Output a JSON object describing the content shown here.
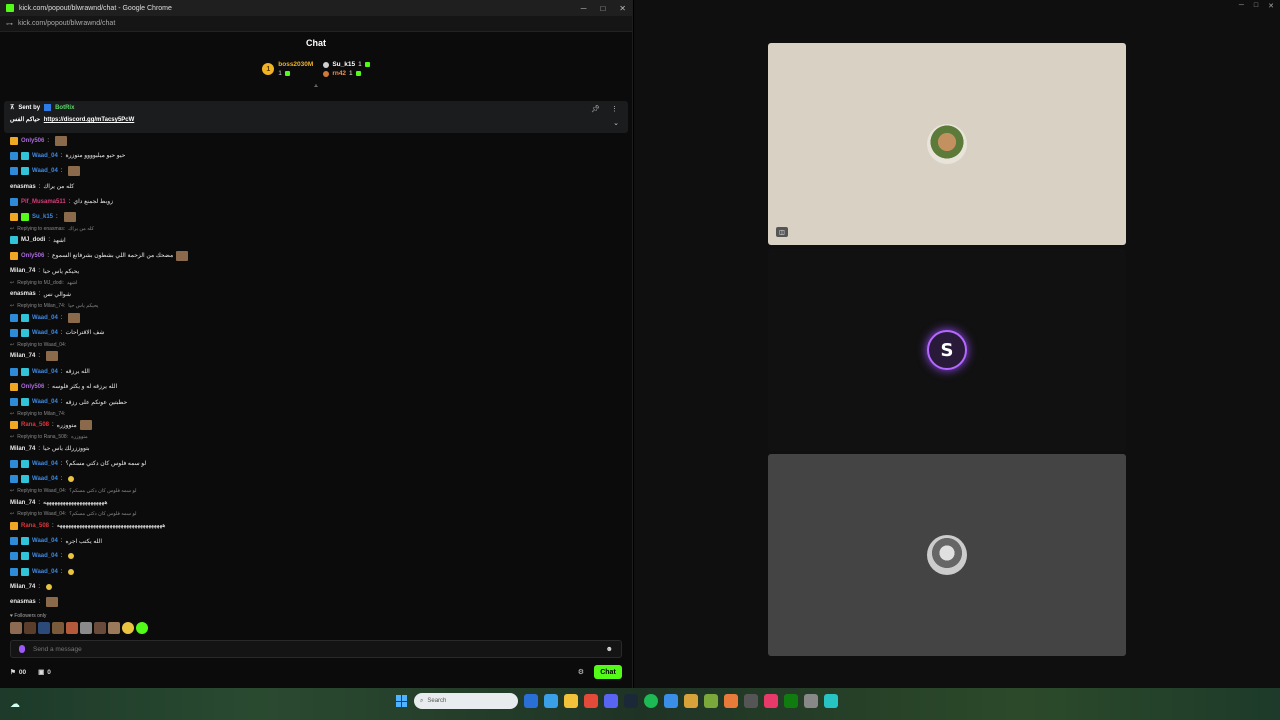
{
  "chrome": {
    "window_title": "kick.com/popout/blwrawnd/chat - Google Chrome",
    "url": "kick.com/popout/blwrawnd/chat",
    "controls": {
      "minimize": "─",
      "maximize": "□",
      "close": "✕"
    }
  },
  "chat": {
    "title": "Chat",
    "leaderboard": {
      "first": {
        "rank": "1",
        "name": "boss2030M",
        "count": "1"
      },
      "second": {
        "name": "Su_k15",
        "count": "1"
      },
      "third": {
        "name": "rn42",
        "count": "1"
      }
    },
    "pinned": {
      "sent_by_label": "Sent by",
      "author": "BotRix",
      "text": "حياكم الفس",
      "link": "https://discord.gg/mTacsy5PcW"
    },
    "messages": [
      {
        "user": "Only506",
        "color": "#a86ad8",
        "badges": [
          "crown"
        ],
        "text": "",
        "emote": true
      },
      {
        "user": "Waad_04",
        "color": "#3d8be3",
        "badges": [
          "mod",
          "sub"
        ],
        "text": "حيو حيو ميليوووو متوزرة"
      },
      {
        "user": "Waad_04",
        "color": "#3d8be3",
        "badges": [
          "mod",
          "sub"
        ],
        "text": "",
        "emote": true
      },
      {
        "user": "enasmas",
        "color": "#e8e8e8",
        "badges": [],
        "text": "كله من يراك"
      },
      {
        "user": "Pif_Musama511",
        "color": "#d93b7c",
        "badges": [
          "mod"
        ],
        "text": "زوبط لجمنع داي"
      },
      {
        "user": "Su_k15",
        "color": "#3d8be3",
        "badges": [
          "crown",
          "og"
        ],
        "text": "",
        "emote": true
      },
      {
        "reply": "Replying to enasmas:",
        "quote": "كله من يراك"
      },
      {
        "user": "MJ_dodi",
        "color": "#e8e8e8",
        "badges": [
          "sub"
        ],
        "text": "اشهد"
      },
      {
        "user": "Only506",
        "color": "#a86ad8",
        "badges": [
          "crown"
        ],
        "text": "مضحك من الزحمة اللي بشطون بشرفاتع السموع",
        "emote": true
      },
      {
        "user": "Milan_74",
        "color": "#e8e8e8",
        "badges": [],
        "text": "يحيكم ياس حيا"
      },
      {
        "reply": "Replying to MJ_dodi:",
        "quote": "اشهد"
      },
      {
        "user": "enasmas",
        "color": "#e8e8e8",
        "badges": [],
        "text": "شوالي نس"
      },
      {
        "reply": "Replying to Milan_74:",
        "quote": "يحيكم ياس حيا"
      },
      {
        "user": "Waad_04",
        "color": "#3d8be3",
        "badges": [
          "mod",
          "sub"
        ],
        "text": "",
        "emote": true
      },
      {
        "user": "Waad_04",
        "color": "#3d8be3",
        "badges": [
          "mod",
          "sub"
        ],
        "text": "شف الاقتراحات"
      },
      {
        "reply": "Replying to Waad_04:",
        "quote": ""
      },
      {
        "user": "Milan_74",
        "color": "#e8e8e8",
        "badges": [],
        "text": "",
        "emote": true
      },
      {
        "user": "Waad_04",
        "color": "#3d8be3",
        "badges": [
          "mod",
          "sub"
        ],
        "text": "الله يرزقه"
      },
      {
        "user": "Only506",
        "color": "#a86ad8",
        "badges": [
          "crown"
        ],
        "text": "الله يرزقه له و يكثر فلوسه"
      },
      {
        "user": "Waad_04",
        "color": "#3d8be3",
        "badges": [
          "mod",
          "sub"
        ],
        "text": "حطبتين عونكم على رزقه"
      },
      {
        "reply": "Replying to Milan_74:",
        "quote": ""
      },
      {
        "user": "Rana_508",
        "color": "#e0353a",
        "badges": [
          "crown"
        ],
        "text": "متووزره",
        "emote": true
      },
      {
        "reply": "Replying to Rana_508:",
        "quote": "متووزره"
      },
      {
        "user": "Milan_74",
        "color": "#e8e8e8",
        "badges": [],
        "text": "بتووززرلك ياس حيا"
      },
      {
        "user": "Waad_04",
        "color": "#3d8be3",
        "badges": [
          "mod",
          "sub"
        ],
        "text": "لو سمه فلوس كان دكتي مسكم؟"
      },
      {
        "user": "Waad_04",
        "color": "#3d8be3",
        "badges": [
          "mod",
          "sub"
        ],
        "text": "",
        "smile": true
      },
      {
        "reply": "Replying to Waad_04:",
        "quote": "لو سمه فلوس كان دكتي مسكم؟"
      },
      {
        "user": "Milan_74",
        "color": "#e8e8e8",
        "badges": [],
        "text": "ههههههههههههههههههههههه"
      },
      {
        "reply": "Replying to Waad_04:",
        "quote": "لو سمه فلوس كان دكتي مسكم؟"
      },
      {
        "user": "Rana_508",
        "color": "#e0353a",
        "badges": [
          "crown"
        ],
        "text": "ههههههههههههههههههههههههههههههههههههههه"
      },
      {
        "user": "Waad_04",
        "color": "#3d8be3",
        "badges": [
          "mod",
          "sub"
        ],
        "text": "الله يكتب اجره"
      },
      {
        "user": "Waad_04",
        "color": "#3d8be3",
        "badges": [
          "mod",
          "sub"
        ],
        "text": "",
        "smile": true
      },
      {
        "user": "Waad_04",
        "color": "#3d8be3",
        "badges": [
          "mod",
          "sub"
        ],
        "text": "",
        "smile": true
      },
      {
        "user": "Milan_74",
        "color": "#e8e8e8",
        "badges": [],
        "text": "",
        "smile": true
      },
      {
        "user": "enasmas",
        "color": "#e8e8e8",
        "badges": [],
        "text": "",
        "emote": true
      }
    ],
    "followers_only": "Followers only",
    "input_placeholder": "Send a message",
    "viewers_count": "00",
    "points_count": "0",
    "send_label": "Chat"
  },
  "call_tiles": [
    {
      "name": "participant-1"
    },
    {
      "name": "participant-2",
      "initial": "S"
    },
    {
      "name": "participant-3"
    }
  ],
  "taskbar": {
    "search_placeholder": "Search"
  },
  "icons": [
    "chat-settings-icon",
    "pin-icon",
    "more-icon",
    "expand-icon",
    "emoji-icon",
    "mic-icon",
    "camera-icon",
    "windows-icon",
    "search-icon"
  ]
}
